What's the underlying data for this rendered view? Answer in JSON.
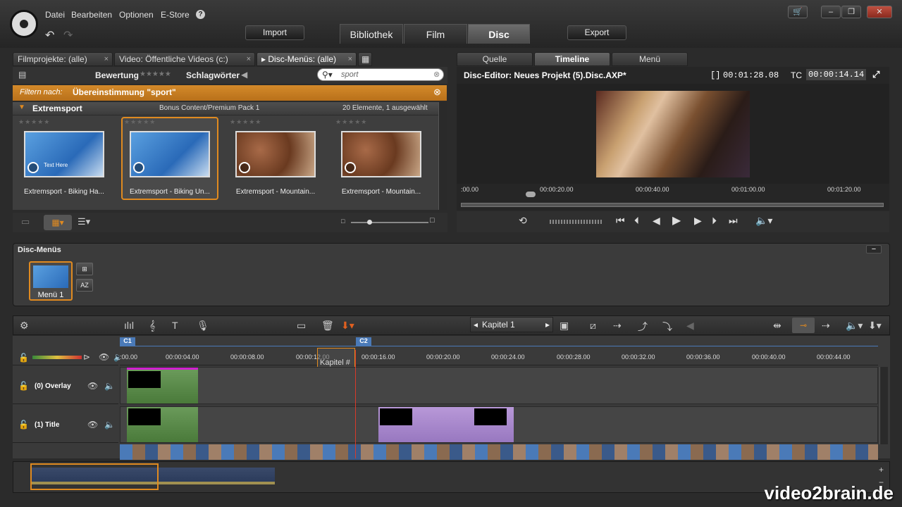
{
  "menu": [
    "Datei",
    "Bearbeiten",
    "Optionen",
    "E-Store"
  ],
  "toolbar": {
    "import": "Import",
    "export": "Export"
  },
  "main_tabs": [
    "Bibliothek",
    "Film",
    "Disc"
  ],
  "library": {
    "tabs": [
      "Filmprojekte: (alle)",
      "Video: Öffentliche Videos (c:)",
      "Disc-Menüs: (alle)"
    ],
    "bewertung": "Bewertung",
    "stars": "★★★★★",
    "schlagwoerter": "Schlagwörter",
    "search_value": "sport",
    "filter_label": "Filtern nach:",
    "filter_value": "Übereinstimmung \"sport\"",
    "group_name": "Extremsport",
    "group_pack": "Bonus Content/Premium Pack 1",
    "group_count": "20 Elemente, 1 ausgewählt",
    "items": [
      {
        "label": "Extremsport - Biking Ha...",
        "stars": "★★★★★",
        "thumb_text": "Text Here"
      },
      {
        "label": "Extremsport - Biking Un...",
        "stars": "★★★★★",
        "thumb_text": ""
      },
      {
        "label": "Extremsport - Mountain...",
        "stars": "★★★★★",
        "thumb_text": ""
      },
      {
        "label": "Extremsport - Mountain...",
        "stars": "★★★★★",
        "thumb_text": ""
      }
    ]
  },
  "editor": {
    "tabs": [
      "Quelle",
      "Timeline",
      "Menü"
    ],
    "title": "Disc-Editor: Neues Projekt (5).Disc.AXP*",
    "duration": "00:01:28.08",
    "tc_label": "TC",
    "timecode": "00:00:14.14",
    "ruler": [
      ":00.00",
      "00:00:20.00",
      "00:00:40.00",
      "00:01:00.00",
      "00:01:20.00"
    ]
  },
  "disc_menus": {
    "title": "Disc-Menüs",
    "item": "Menü 1",
    "az": "AZ"
  },
  "timeline": {
    "chapter": "Kapitel 1",
    "markers": [
      "C1",
      "C2"
    ],
    "ruler": [
      ":00.00",
      "00:00:04.00",
      "00:00:08.00",
      "00:00:12.00",
      "00:00:16.00",
      "00:00:20.00",
      "00:00:24.00",
      "00:00:28.00",
      "00:00:32.00",
      "00:00:36.00",
      "00:00:40.00",
      "00:00:44.00"
    ],
    "tracks": [
      "(0) Overlay",
      "(1) Title"
    ],
    "drag_label": "Kapitel #"
  },
  "watermark": "video2brain.de"
}
